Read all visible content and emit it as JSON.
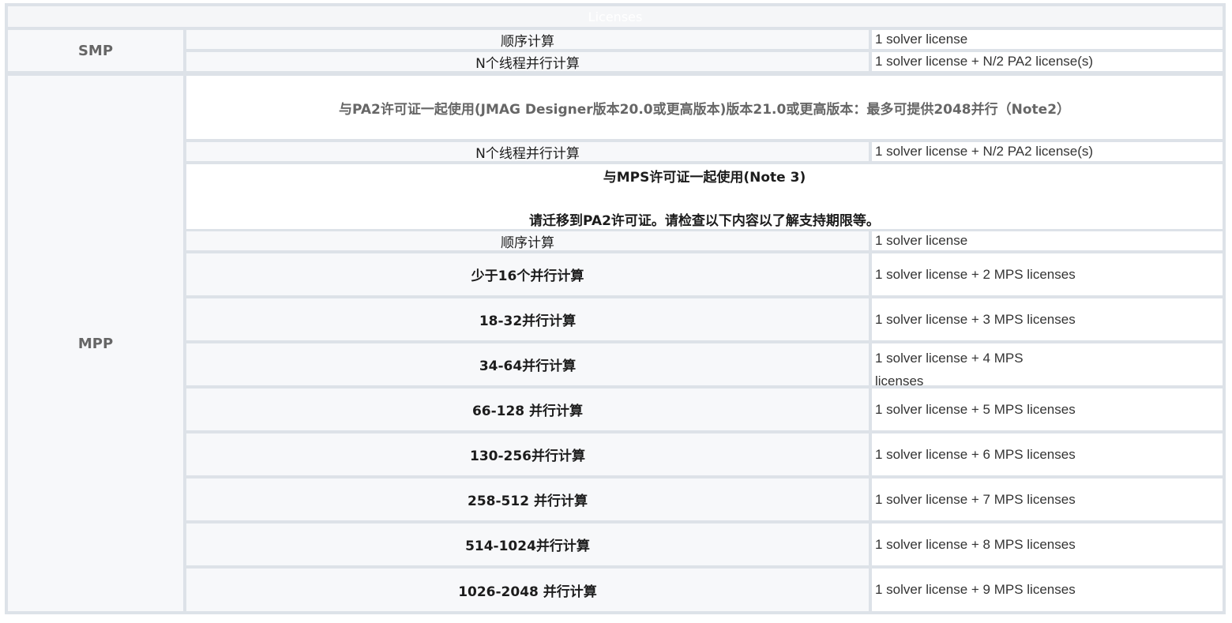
{
  "table": {
    "header": "Licenses",
    "smp": {
      "label": "SMP",
      "rows": [
        {
          "label": "顺序计算",
          "value": "1 solver license"
        },
        {
          "label": "N个线程并行计算",
          "value": "1 solver license + N/2 PA2 license(s)"
        }
      ]
    },
    "mpp": {
      "label": "MPP",
      "pa2_note": "与PA2许可证一起使用(JMAG Designer版本20.0或更高版本)版本21.0或更高版本：最多可提供2048并行（Note2）",
      "pa2_rows": [
        {
          "label": "N个线程并行计算",
          "value": "1 solver license + N/2 PA2 license(s)"
        }
      ],
      "mps_note_line1": "与MPS许可证一起使用(Note 3)",
      "mps_note_line2": "请迁移到PA2许可证。请检查以下内容以了解支持期限等。",
      "mps_rows": [
        {
          "label": "顺序计算",
          "value": "1 solver license"
        },
        {
          "label": "少于16个并行计算",
          "value": "1 solver license + 2 MPS licenses"
        },
        {
          "label": "18-32并行计算",
          "value": "1 solver license + 3 MPS licenses"
        },
        {
          "label": "34-64并行计算",
          "value": "1 solver license + 4 MPS licenses"
        },
        {
          "label": "66-128 并行计算",
          "value": "1 solver license + 5 MPS licenses"
        },
        {
          "label": "130-256并行计算",
          "value": "1 solver license + 6 MPS licenses"
        },
        {
          "label": "258-512 并行计算",
          "value": "1 solver license + 7 MPS licenses"
        },
        {
          "label": "514-1024并行计算",
          "value": "1 solver license + 8 MPS licenses"
        },
        {
          "label": "1026-2048 并行计算",
          "value": "1 solver license + 9 MPS licenses"
        }
      ]
    }
  }
}
